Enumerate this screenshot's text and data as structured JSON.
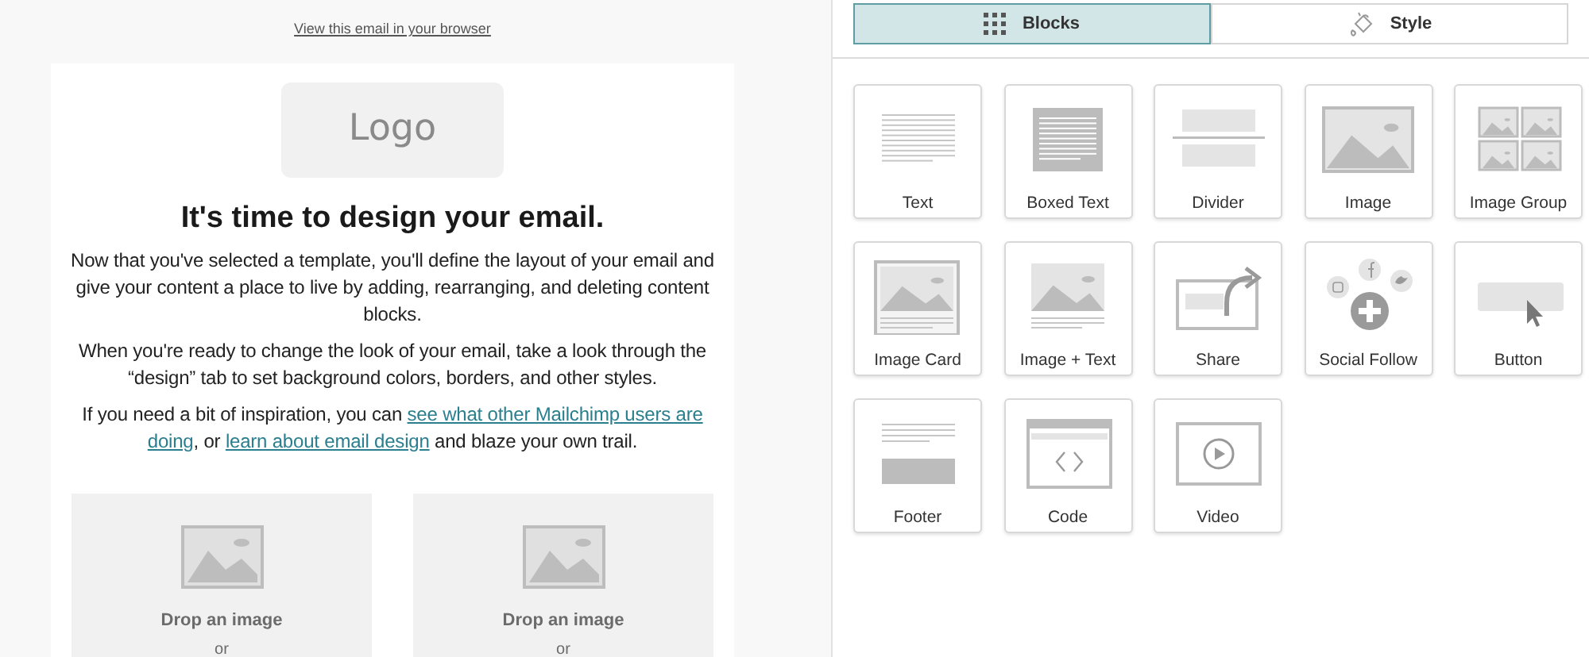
{
  "preview": {
    "browser_link": "View this email in your browser",
    "logo": "Logo",
    "heading": "It's time to design your email.",
    "paragraphs": [
      "Now that you've selected a template, you'll define the layout of your email and give your content a place to live by adding, rearranging, and deleting content blocks.",
      "When you're ready to change the look of your email, take a look through the “design” tab to set background colors, borders, and other styles."
    ],
    "inspiration": [
      {
        "kind": "text",
        "text": "If you need a bit of inspiration, you can"
      },
      {
        "kind": "link",
        "text": "see what other Mailchimp users are"
      },
      {
        "kind": "link",
        "text": "doing"
      },
      {
        "kind": "text",
        "text": ", or"
      },
      {
        "kind": "link",
        "text": "learn about email design"
      },
      {
        "kind": "text",
        "text": "and blaze your own trail."
      }
    ],
    "image_drops": [
      {
        "label": "Drop an image",
        "or": "or"
      },
      {
        "label": "Drop an image",
        "or": "or"
      }
    ]
  },
  "tabs": [
    {
      "kind": "blocks",
      "label": "Blocks",
      "selected": true
    },
    {
      "kind": "style",
      "label": "Style",
      "selected": false
    }
  ],
  "blocks": [
    {
      "kind": "text",
      "label": "Text"
    },
    {
      "kind": "boxed_text",
      "label": "Boxed Text"
    },
    {
      "kind": "divider",
      "label": "Divider"
    },
    {
      "kind": "image",
      "label": "Image"
    },
    {
      "kind": "image_group",
      "label": "Image Group"
    },
    {
      "kind": "image_card",
      "label": "Image Card"
    },
    {
      "kind": "image_text",
      "label": "Image + Text"
    },
    {
      "kind": "share",
      "label": "Share"
    },
    {
      "kind": "social_follow",
      "label": "Social Follow"
    },
    {
      "kind": "button",
      "label": "Button"
    },
    {
      "kind": "footer",
      "label": "Footer"
    },
    {
      "kind": "code",
      "label": "Code"
    },
    {
      "kind": "video",
      "label": "Video"
    }
  ]
}
